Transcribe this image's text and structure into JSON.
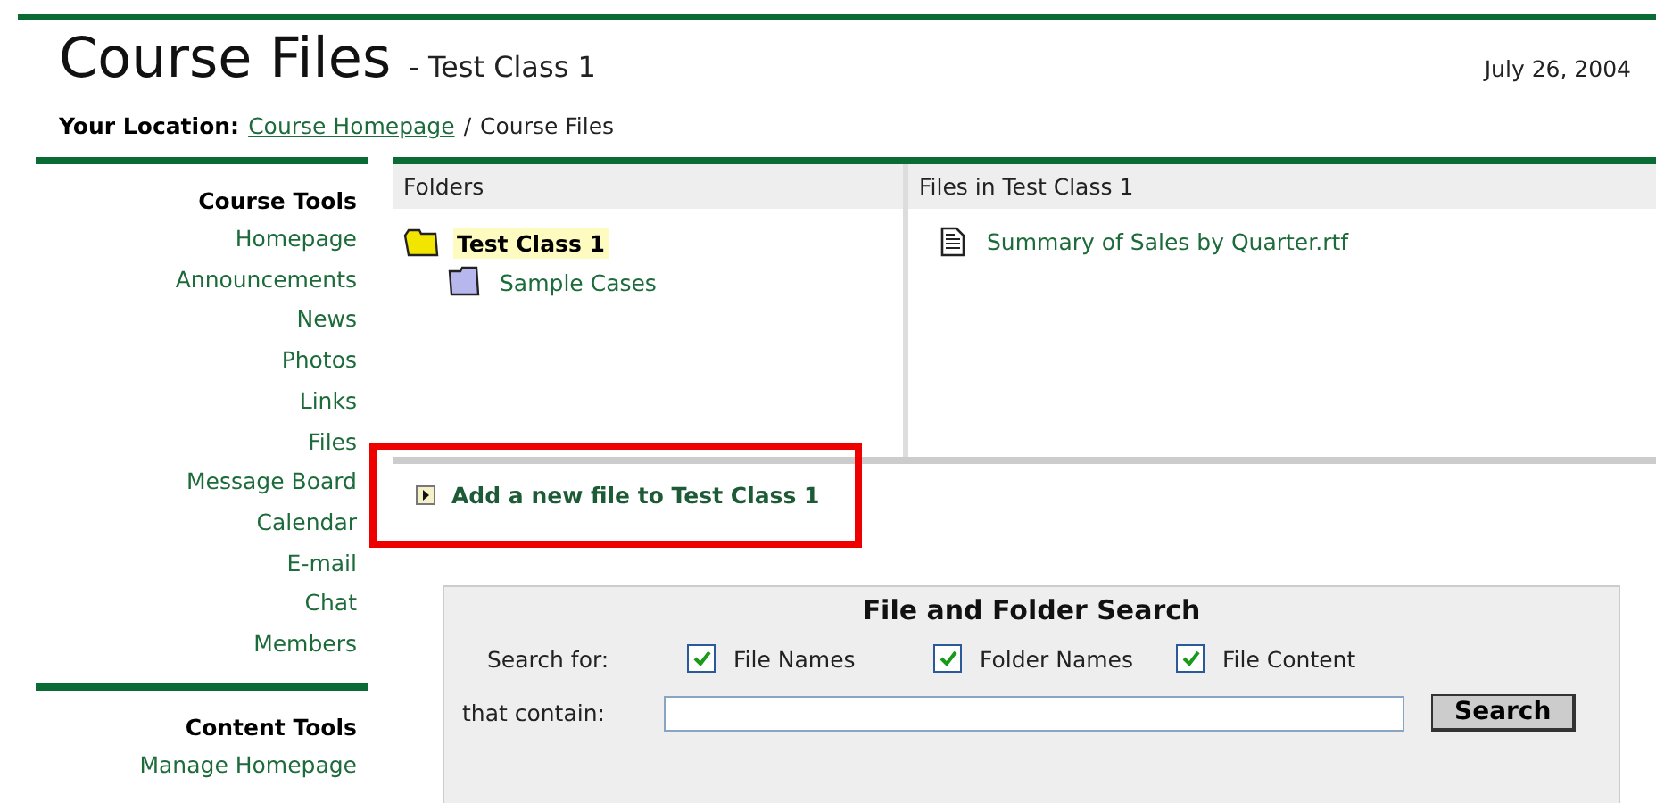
{
  "page": {
    "title": "Course Files",
    "subtitle": "- Test Class 1",
    "date": "July 26, 2004"
  },
  "breadcrumb": {
    "label": "Your Location:",
    "link": "Course Homepage",
    "separator": "/",
    "current": "Course Files"
  },
  "sidebar": [
    {
      "heading": "Course Tools",
      "items": [
        "Homepage",
        "Announcements",
        "News",
        "Photos",
        "Links",
        "Files",
        "Message Board",
        "Calendar",
        "E-mail",
        "Chat",
        "Members"
      ]
    },
    {
      "heading": "Content Tools",
      "items": [
        "Manage Homepage"
      ]
    }
  ],
  "folders": {
    "header": "Folders",
    "items": [
      {
        "name": "Test Class 1",
        "selected": true,
        "children": [
          {
            "name": "Sample Cases",
            "selected": false
          }
        ]
      }
    ]
  },
  "files": {
    "header": "Files in Test Class 1",
    "items": [
      "Summary of Sales by Quarter.rtf"
    ]
  },
  "add_link": {
    "label": "Add a new file to Test Class 1",
    "highlighted": true
  },
  "search": {
    "title": "File and Folder Search",
    "search_for_label": "Search for:",
    "options": [
      {
        "label": "File Names",
        "checked": true
      },
      {
        "label": "Folder Names",
        "checked": true
      },
      {
        "label": "File Content",
        "checked": true
      }
    ],
    "contain_label": "that contain:",
    "button": "Search"
  }
}
